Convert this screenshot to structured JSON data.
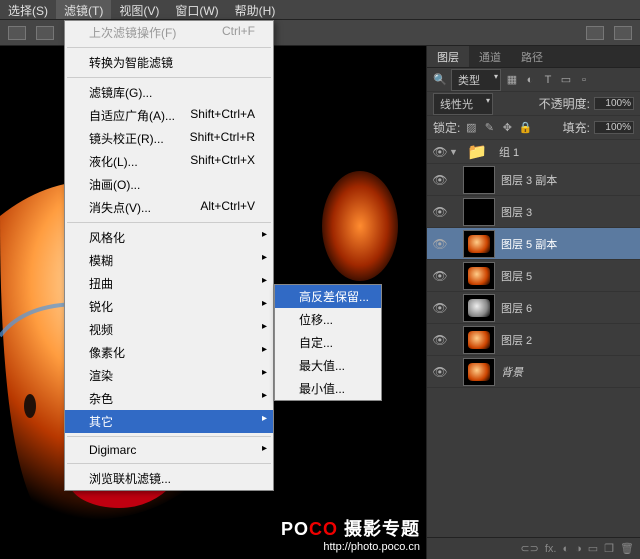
{
  "menubar": [
    {
      "label": "选择(S)"
    },
    {
      "label": "滤镜(T)"
    },
    {
      "label": "视图(V)"
    },
    {
      "label": "窗口(W)"
    },
    {
      "label": "帮助(H)"
    }
  ],
  "menu1": {
    "last": "上次滤镜操作(F)",
    "last_sc": "Ctrl+F",
    "convert": "转换为智能滤镜",
    "gallery": "滤镜库(G)...",
    "wide": "自适应广角(A)...",
    "wide_sc": "Shift+Ctrl+A",
    "lens": "镜头校正(R)...",
    "lens_sc": "Shift+Ctrl+R",
    "liq": "液化(L)...",
    "liq_sc": "Shift+Ctrl+X",
    "oil": "油画(O)...",
    "van": "消失点(V)...",
    "van_sc": "Alt+Ctrl+V",
    "stylize": "风格化",
    "blur": "模糊",
    "distort": "扭曲",
    "sharp": "锐化",
    "video": "视频",
    "pixel": "像素化",
    "render": "渲染",
    "noise": "杂色",
    "other": "其它",
    "digimarc": "Digimarc",
    "browse": "浏览联机滤镜..."
  },
  "menu2": {
    "highpass": "高反差保留...",
    "offset": "位移...",
    "custom": "自定...",
    "max": "最大值...",
    "min": "最小值..."
  },
  "tabs": {
    "layers": "图层",
    "channels": "通道",
    "paths": "路径"
  },
  "kind_label": "类型",
  "blend": "线性光",
  "opacity_lbl": "不透明度:",
  "opacity_val": "100%",
  "lock_lbl": "锁定:",
  "fill_lbl": "填充:",
  "fill_val": "100%",
  "layers": [
    {
      "name": "组 1",
      "type": "group"
    },
    {
      "name": "图层 3 副本",
      "thumb": "black"
    },
    {
      "name": "图层 3",
      "thumb": "black"
    },
    {
      "name": "图层 5 副本",
      "thumb": "orange",
      "sel": true
    },
    {
      "name": "图层 5",
      "thumb": "orange"
    },
    {
      "name": "图层 6",
      "thumb": "gray"
    },
    {
      "name": "图层 2",
      "thumb": "orange"
    },
    {
      "name": "背景",
      "thumb": "orange",
      "italic": true
    }
  ],
  "watermark": {
    "brand1": "PO",
    "brand2": "CO",
    "sub": "摄影专题",
    "url": "http://photo.poco.cn"
  }
}
